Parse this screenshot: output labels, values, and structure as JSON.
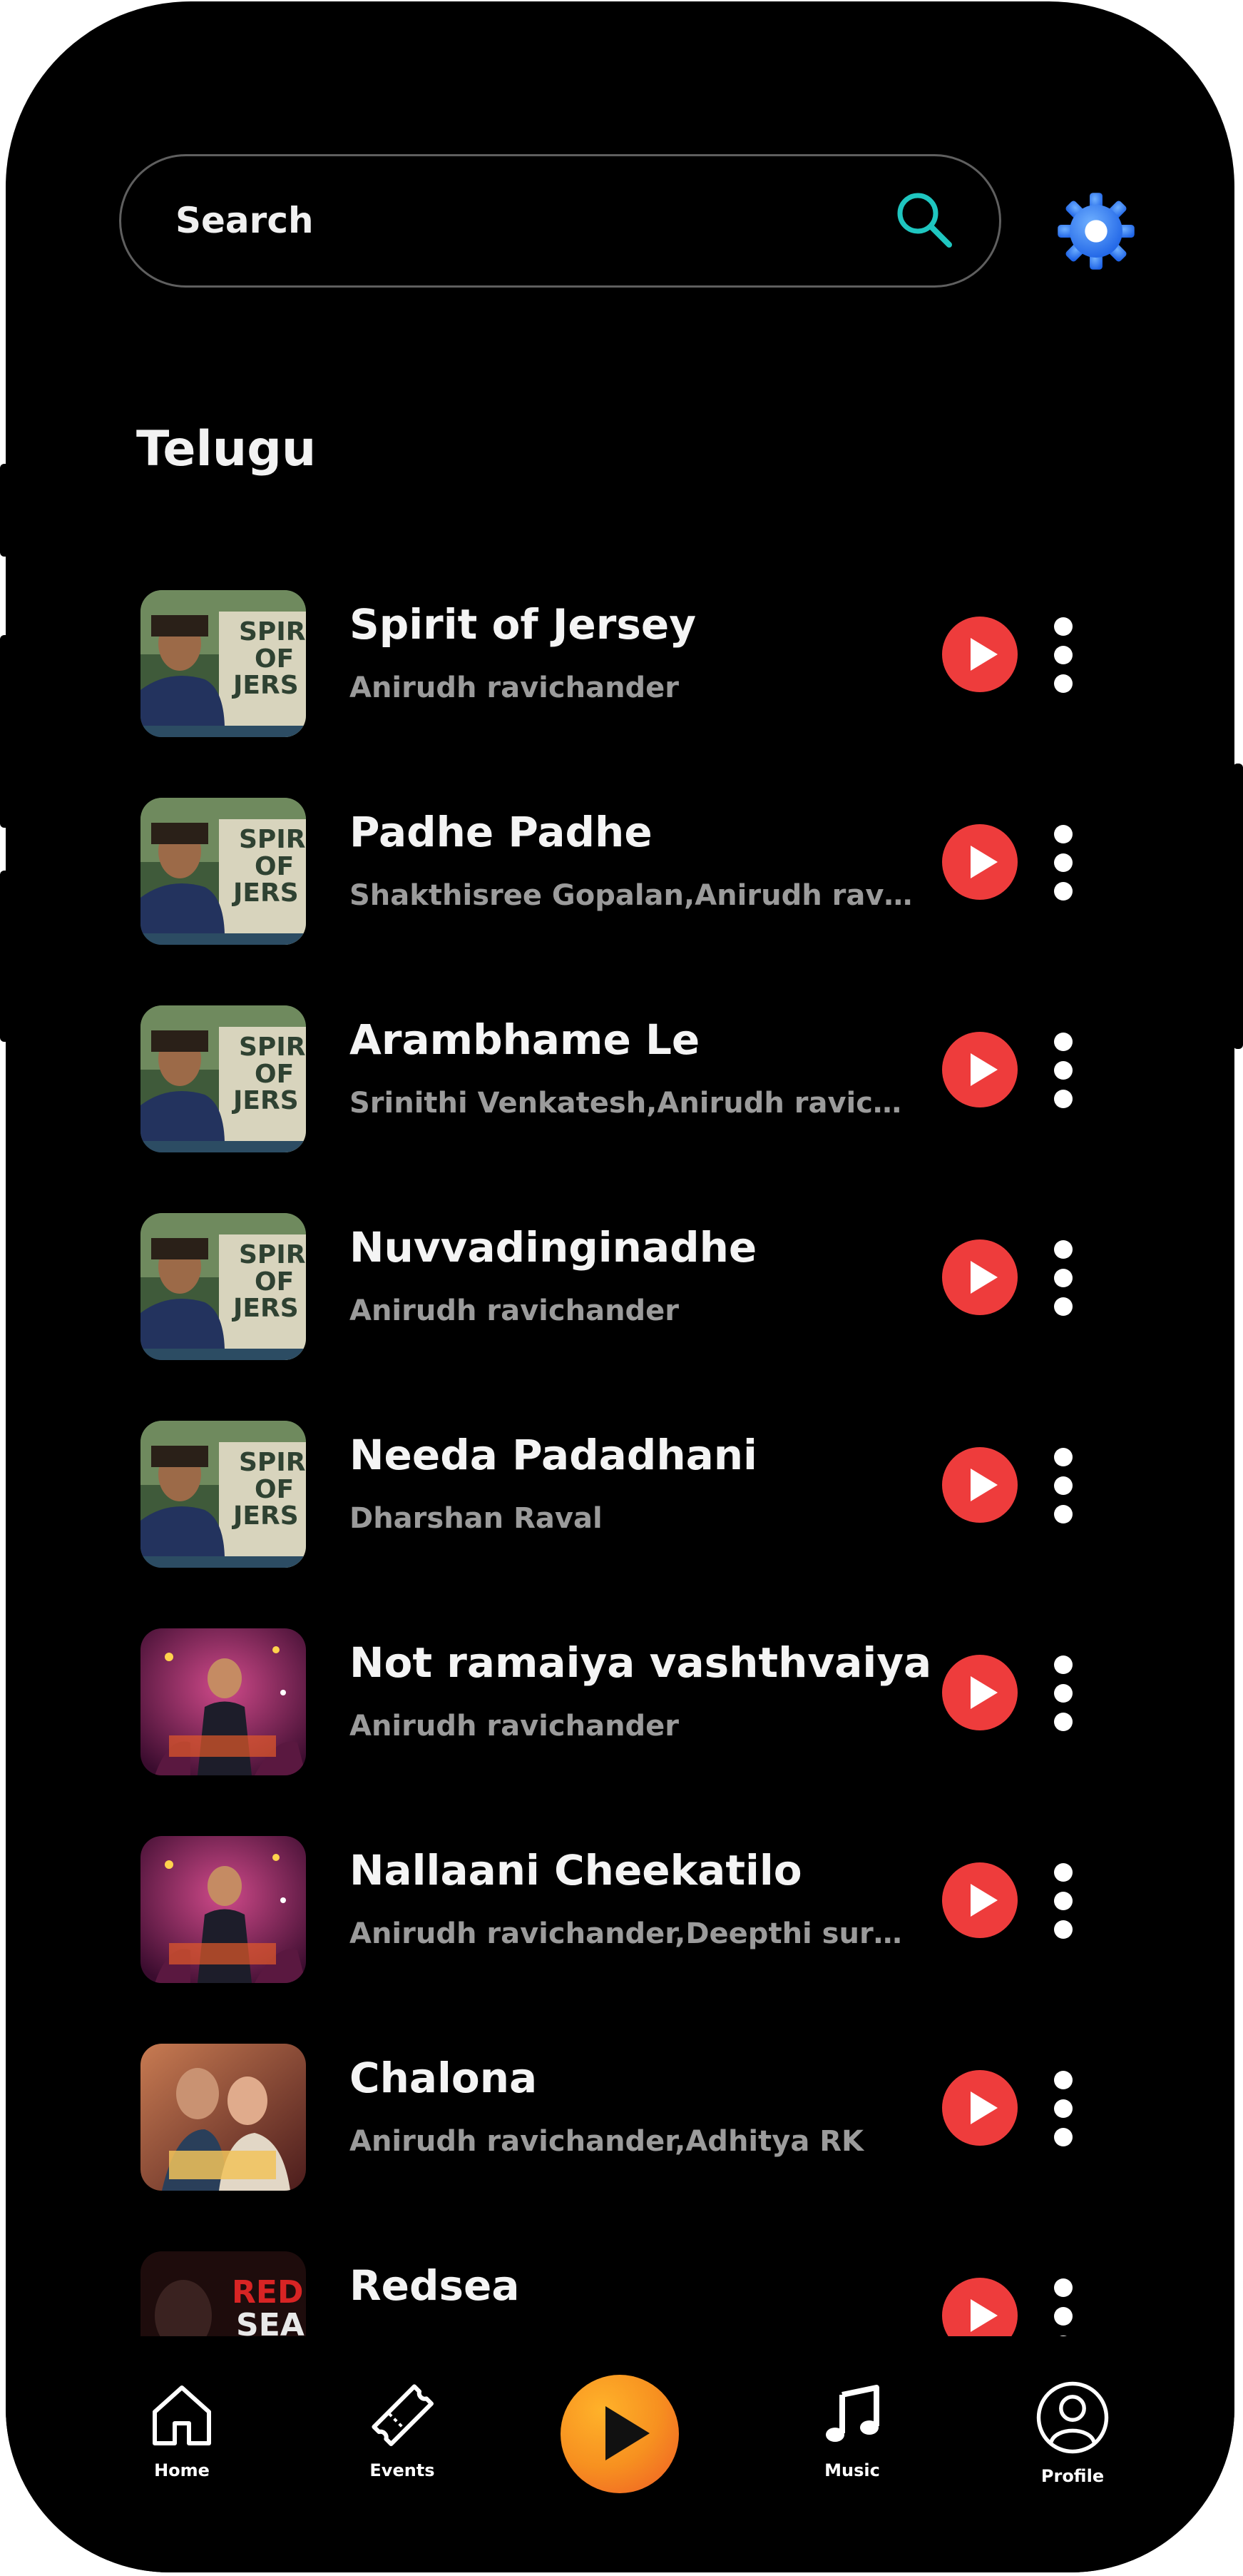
{
  "search": {
    "placeholder": "Search"
  },
  "section": {
    "title": "Telugu"
  },
  "songs": [
    {
      "title": "Spirit of Jersey",
      "artist": "Anirudh ravichander",
      "art": "jersey"
    },
    {
      "title": "Padhe Padhe",
      "artist": "Shakthisree Gopalan,Anirudh ravichander",
      "art": "jersey"
    },
    {
      "title": "Arambhame Le",
      "artist": "Srinithi Venkatesh,Anirudh ravichander",
      "art": "jersey"
    },
    {
      "title": "Nuvvadinginadhe",
      "artist": "Anirudh ravichander",
      "art": "jersey"
    },
    {
      "title": "Needa Padadhani",
      "artist": "Dharshan Raval",
      "art": "jersey"
    },
    {
      "title": "Not ramaiya vashthvaiya",
      "artist": "Anirudh ravichander",
      "art": "party"
    },
    {
      "title": "Nallaani Cheekatilo",
      "artist": "Anirudh ravichander,Deepthi suresh",
      "art": "party"
    },
    {
      "title": "Chalona",
      "artist": "Anirudh ravichander,Adhitya RK",
      "art": "couple"
    },
    {
      "title": "Redsea",
      "artist": "",
      "art": "redsea"
    }
  ],
  "nav": {
    "home": "Home",
    "events": "Events",
    "music": "Music",
    "profile": "Profile"
  },
  "colors": {
    "background": "#000000",
    "play_button": "#ee3c3c",
    "center_play": "#f79120",
    "gear": "#2f7df6",
    "search_icon": "#1fc6c0"
  },
  "icons": {
    "search": "search-icon",
    "settings": "gear-icon",
    "play": "play-icon",
    "more": "more-vertical-icon",
    "home": "home-icon",
    "events": "ticket-icon",
    "music": "music-note-icon",
    "profile": "user-circle-icon"
  }
}
